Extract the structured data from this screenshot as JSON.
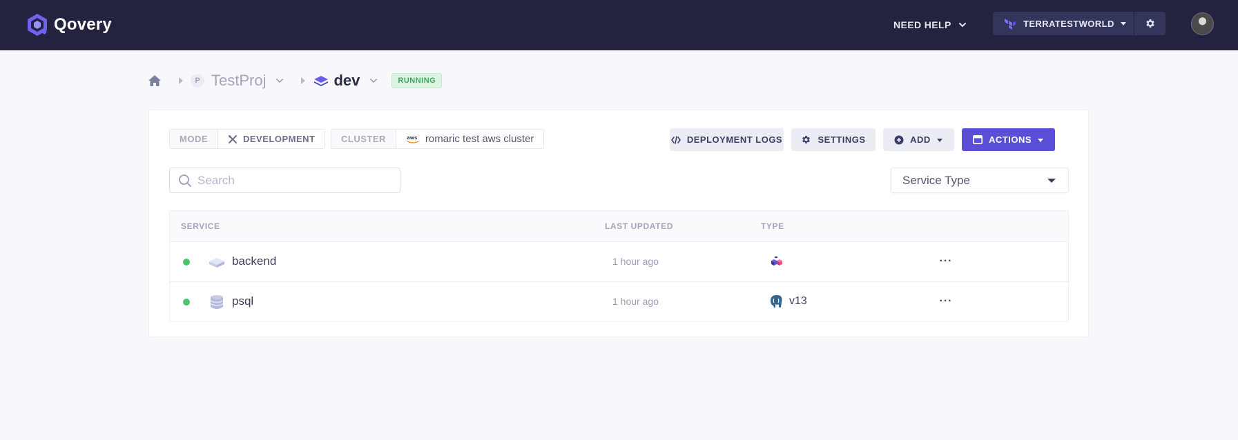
{
  "brand": {
    "name": "Qovery",
    "icon": "qovery-logo"
  },
  "topbar": {
    "help_label": "NEED HELP",
    "org_name": "TERRATESTWORLD",
    "org_icon": "terraform-icon",
    "settings_icon": "gear-icon",
    "avatar": "user-avatar"
  },
  "breadcrumb": {
    "home_icon": "home-icon",
    "project_initial": "P",
    "project_name": "TestProj",
    "environment_name": "dev",
    "environment_icon": "environment-layers-icon",
    "status": "RUNNING"
  },
  "tags": {
    "mode_key": "MODE",
    "mode_value": "DEVELOPMENT",
    "cluster_key": "CLUSTER",
    "cluster_provider": "aws",
    "cluster_value": "romaric test aws cluster"
  },
  "toolbar": {
    "deployment_logs": "DEPLOYMENT LOGS",
    "settings": "SETTINGS",
    "add": "ADD",
    "actions": "ACTIONS"
  },
  "search": {
    "placeholder": "Search",
    "value": ""
  },
  "filter": {
    "selected": "Service Type"
  },
  "table": {
    "headers": {
      "service": "SERVICE",
      "last_updated": "LAST UPDATED",
      "type": "TYPE"
    },
    "rows": [
      {
        "name": "backend",
        "status": "running",
        "icon": "application-icon",
        "last_updated": "1 hour ago",
        "type_icon": "container-icon",
        "type_version": ""
      },
      {
        "name": "psql",
        "status": "running",
        "icon": "database-icon",
        "last_updated": "1 hour ago",
        "type_icon": "postgresql-icon",
        "type_version": "v13"
      }
    ],
    "more_label": "···"
  },
  "colors": {
    "topbar": "#232340",
    "accent": "#5a4fd6",
    "status_green": "#4cc46b",
    "running_badge_bg": "#dcf5e3"
  }
}
